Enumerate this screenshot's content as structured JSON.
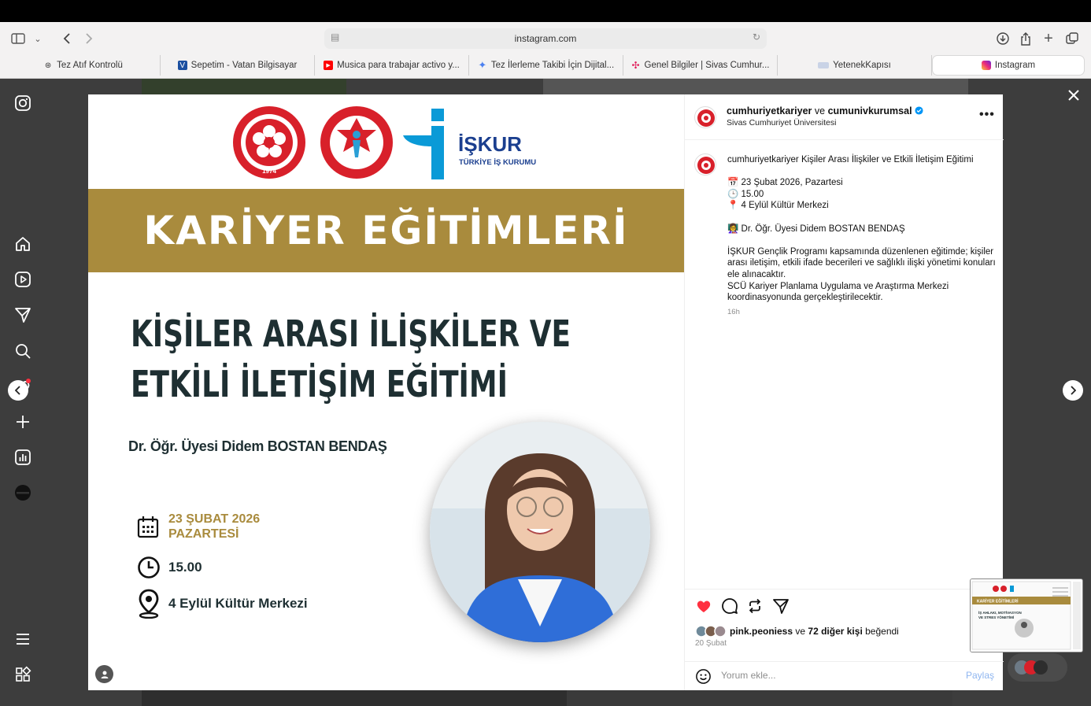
{
  "browser": {
    "url": "instagram.com",
    "tabs": [
      {
        "label": "Tez Atıf Kontrolü",
        "icon": "openai-icon"
      },
      {
        "label": "Sepetim - Vatan Bilgisayar",
        "icon": "vatan-icon"
      },
      {
        "label": "Musica para trabajar activo y...",
        "icon": "youtube-icon"
      },
      {
        "label": "Tez İlerleme Takibi İçin Dijital...",
        "icon": "gemini-icon"
      },
      {
        "label": "Genel Bilgiler | Sivas Cumhur...",
        "icon": "slack-icon"
      },
      {
        "label": "YetenekKapısı",
        "icon": "yetenek-icon"
      },
      {
        "label": "Instagram",
        "icon": "instagram-icon"
      }
    ]
  },
  "poster": {
    "iskur_name": "İŞKUR",
    "iskur_sub": "TÜRKİYE İŞ KURUMU",
    "seal_year": "1974",
    "band_title": "KARİYER EĞİTİMLERİ",
    "headline_line1": "KİŞİLER ARASI İLİŞKİLER VE",
    "headline_line2": "ETKİLİ İLETİŞİM EĞİTİMİ",
    "speaker": "Dr. Öğr. Üyesi Didem BOSTAN BENDAŞ",
    "date_line1": "23 ŞUBAT 2026",
    "date_line2": "PAZARTESİ",
    "time": "15.00",
    "location": "4 Eylül Kültür Merkezi"
  },
  "post": {
    "author1": "cumhuriyetkariyer",
    "joiner": "ve",
    "author2": "cumunivkurumsal",
    "subtitle": "Sivas Cumhuriyet Üniversitesi",
    "caption_author": "cumhuriyetkariyer",
    "caption_title": "Kişiler Arası İlişkiler ve Etkili İletişim Eğitimi",
    "line_date": "📅 23 Şubat 2026, Pazartesi",
    "line_time": "🕒 15.00",
    "line_place": "📍 4 Eylül Kültür Merkezi",
    "line_speaker": "👩‍🏫 Dr. Öğr. Üyesi Didem BOSTAN BENDAŞ",
    "body1": "İŞKUR Gençlik Programı kapsamında düzenlenen eğitimde; kişiler arası iletişim, etkili ifade becerileri ve sağlıklı ilişki yönetimi konuları ele alınacaktır.",
    "body2": "SCÜ Kariyer Planlama Uygulama ve Araştırma Merkezi koordinasyonunda gerçekleştirilecektir.",
    "age": "16h",
    "liker": "pink.peoniess",
    "likes_joiner": "ve",
    "likes_others": "72 diğer kişi",
    "likes_suffix": "beğendi",
    "date": "20 Şubat",
    "comment_placeholder": "Yorum ekle...",
    "share_label": "Paylaş"
  },
  "mini_preview": {
    "band": "KARİYER EĞİTİMLERİ",
    "title1": "İŞ AHLAKI, MOTİVASYON",
    "title2": "VE STRES YÖNETİMİ"
  },
  "colors": {
    "band": "#a98b3d",
    "headline": "#1e2f32",
    "like": "#ff3040",
    "verified": "#0095f6",
    "iskur_blue": "#0a9ad7",
    "seal_red": "#d8202a"
  }
}
